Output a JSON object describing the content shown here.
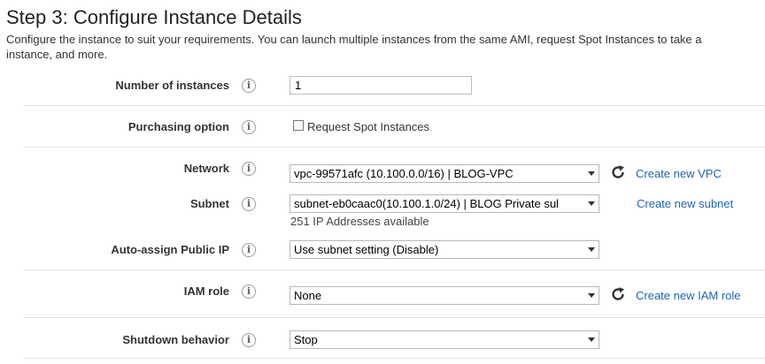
{
  "page": {
    "title": "Step 3: Configure Instance Details",
    "description_line1": "Configure the instance to suit your requirements. You can launch multiple instances from the same AMI, request Spot Instances to take a",
    "description_line2": "instance, and more."
  },
  "info_icon_glyph": "i",
  "fields": {
    "instances": {
      "label": "Number of instances",
      "value": "1"
    },
    "purchasing": {
      "label": "Purchasing option",
      "checkbox_label": "Request Spot Instances",
      "checked": false
    },
    "network": {
      "label": "Network",
      "selected": "vpc-99571afc (10.100.0.0/16) | BLOG-VPC",
      "link": "Create new VPC"
    },
    "subnet": {
      "label": "Subnet",
      "selected": "subnet-eb0caac0(10.100.1.0/24) | BLOG Private sul",
      "available": "251 IP Addresses available",
      "link": "Create new subnet"
    },
    "public_ip": {
      "label": "Auto-assign Public IP",
      "selected": "Use subnet setting (Disable)"
    },
    "iam_role": {
      "label": "IAM role",
      "selected": "None",
      "link": "Create new IAM role"
    },
    "shutdown": {
      "label": "Shutdown behavior",
      "selected": "Stop"
    }
  },
  "colors": {
    "link": "#1f63b8",
    "separator": "#e3e3e3",
    "icon": "#666666"
  }
}
